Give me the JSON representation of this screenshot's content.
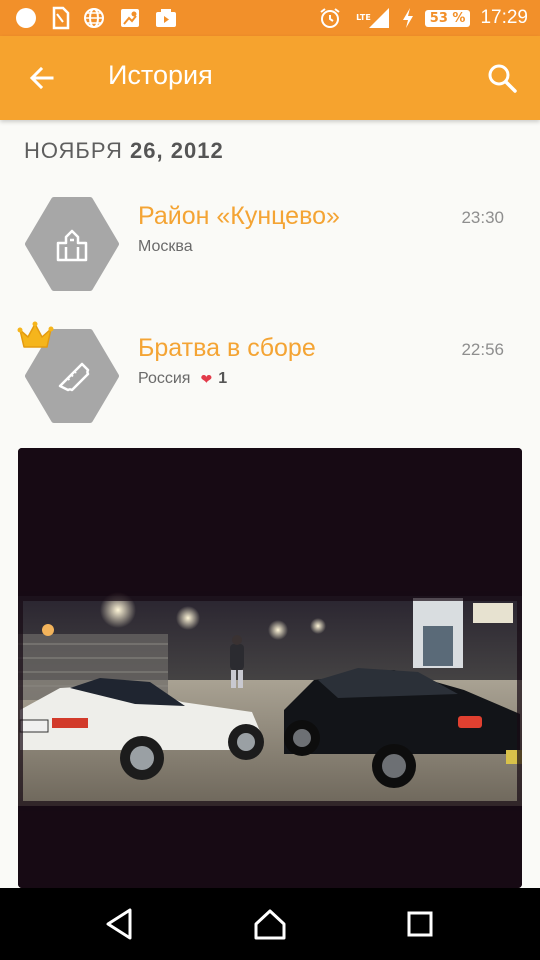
{
  "status_bar": {
    "time": "17:29",
    "battery": "53 %",
    "network": "LTE",
    "icons": [
      "dot-icon",
      "sim-icon",
      "globe-icon",
      "map-icon",
      "photo-icon",
      "alarm-icon",
      "signal-icon",
      "charging-icon"
    ]
  },
  "app_bar": {
    "title": "История",
    "back_icon": "arrow-left-icon",
    "search_icon": "search-icon"
  },
  "date_header": {
    "month": "НОЯБРЯ",
    "day_year": "26, 2012"
  },
  "entries": [
    {
      "name": "Район «Кунцево»",
      "subtitle": "Москва",
      "time": "23:30",
      "icon": "buildings-icon"
    },
    {
      "name": "Братва в сборе",
      "subtitle": "Россия",
      "time": "22:56",
      "icon": "ticket-icon",
      "likes": "1",
      "badge_icon": "crown-icon"
    }
  ],
  "colors": {
    "status_bar": "#f2902a",
    "app_bar": "#f6a32e",
    "accent_text": "#f4a434",
    "hex_badge": "#a7a7a7",
    "heart": "#e23b4a"
  }
}
